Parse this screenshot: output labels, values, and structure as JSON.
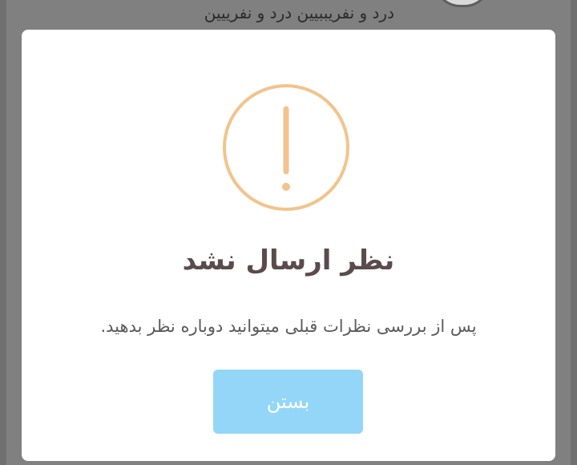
{
  "background": {
    "comment_text": "درد و نفریببیین درد و نفرییین",
    "overlay_color": "#808080"
  },
  "dialog": {
    "icon": "exclamation-circle-icon",
    "icon_color": "#f3c38b",
    "title": "نظر ارسال نشد",
    "message": "پس از بررسی نظرات قبلی میتوانید دوباره نظر بدهید.",
    "close_label": "بستن",
    "close_button_color": "#94d6f7"
  }
}
